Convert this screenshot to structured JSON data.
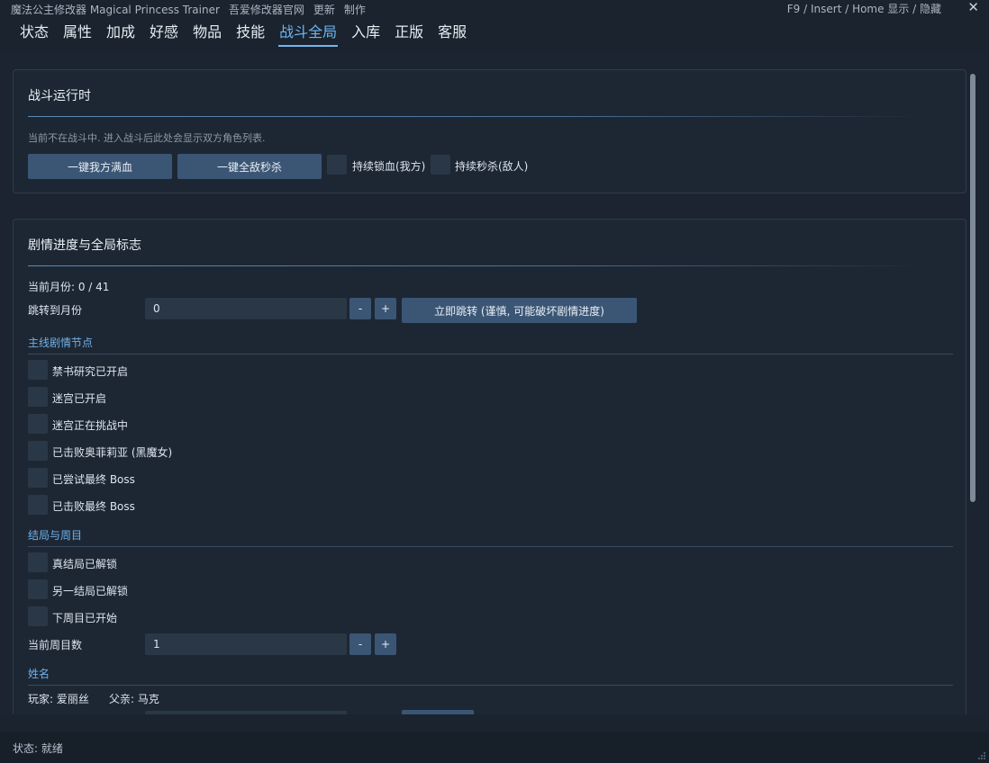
{
  "window": {
    "title": "魔法公主修改器 Magical Princess Trainer",
    "links": [
      "吾爱修改器官网",
      "更新",
      "制作"
    ],
    "hotkey": "F9 / Insert / Home  显示 / 隐藏",
    "close_glyph": "✕"
  },
  "tabs": [
    {
      "label": "状态"
    },
    {
      "label": "属性"
    },
    {
      "label": "加成"
    },
    {
      "label": "好感"
    },
    {
      "label": "物品"
    },
    {
      "label": "技能"
    },
    {
      "label": "战斗全局",
      "active": true
    },
    {
      "label": "入库"
    },
    {
      "label": "正版"
    },
    {
      "label": "客服"
    }
  ],
  "battle": {
    "title": "战斗运行时",
    "hint": "当前不在战斗中. 进入战斗后此处会显示双方角色列表.",
    "btn_full_hp": "一键我方满血",
    "btn_kill_all": "一键全敌秒杀",
    "chk_lock_hp": "持续锁血(我方)",
    "chk_kill_enemy": "持续秒杀(敌人)"
  },
  "story": {
    "title": "剧情进度与全局标志",
    "current_month": "当前月份: 0 / 41",
    "jump_label": "跳转到月份",
    "jump_value": "0",
    "minus": "-",
    "plus": "+",
    "jump_button": "立即跳转 (谨慎, 可能破坏剧情进度)",
    "main_section": "主线剧情节点",
    "main_flags": [
      "禁书研究已开启",
      "迷宫已开启",
      "迷宫正在挑战中",
      "已击败奥菲莉亚 (黑魔女)",
      "已尝试最终 Boss",
      "已击败最终 Boss"
    ],
    "ending_section": "结局与周目",
    "ending_flags": [
      "真结局已解锁",
      "另一结局已解锁",
      "下周目已开始"
    ],
    "cycle_label": "当前周目数",
    "cycle_value": "1",
    "name_section": "姓名",
    "player_name": "玩家: 爱丽丝",
    "father_name": "父亲: 马克"
  },
  "status": {
    "text": "状态: 就绪"
  },
  "colors": {
    "accent": "#6fb6f0",
    "button": "#3b5675",
    "background": "#1a232e"
  }
}
